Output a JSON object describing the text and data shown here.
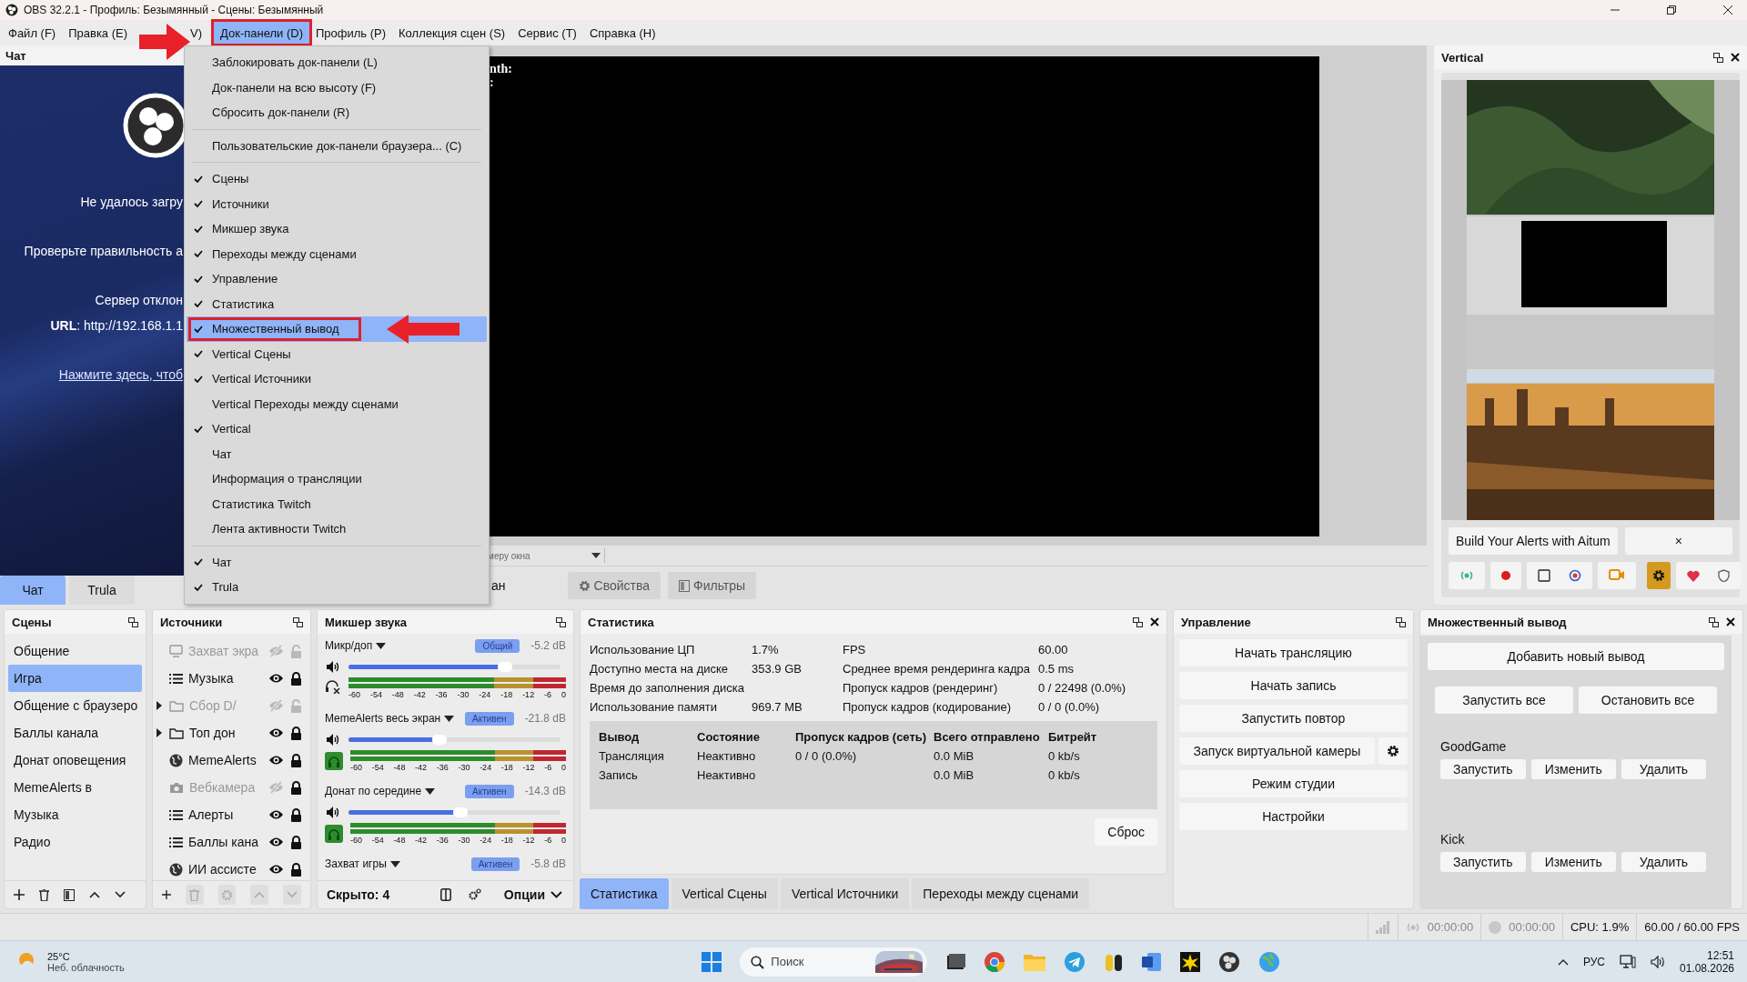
{
  "window": {
    "title": "OBS 32.2.1 - Профиль: Безымянный - Сцены: Безымянный"
  },
  "menubar": [
    {
      "label": "Файл (F)",
      "selected": false
    },
    {
      "label": "Правка (E)",
      "selected": false
    },
    {
      "label": "V)",
      "selected": false
    },
    {
      "label": "Док-панели (D)",
      "selected": true
    },
    {
      "label": "Профиль (P)",
      "selected": false
    },
    {
      "label": "Коллекция сцен (S)",
      "selected": false
    },
    {
      "label": "Сервис (T)",
      "selected": false
    },
    {
      "label": "Справка (H)",
      "selected": false
    }
  ],
  "dock_menu": {
    "groups": [
      [
        {
          "label": "Заблокировать док-панели (L)",
          "checked": false,
          "selected": false
        },
        {
          "label": "Док-панели на всю высоту (F)",
          "checked": false,
          "selected": false
        },
        {
          "label": "Сбросить док-панели (R)",
          "checked": false,
          "selected": false
        }
      ],
      [
        {
          "label": "Пользовательские док-панели браузера... (C)",
          "checked": false,
          "selected": false
        }
      ],
      [
        {
          "label": "Сцены",
          "checked": true,
          "selected": false
        },
        {
          "label": "Источники",
          "checked": true,
          "selected": false
        },
        {
          "label": "Микшер звука",
          "checked": true,
          "selected": false
        },
        {
          "label": "Переходы между сценами",
          "checked": true,
          "selected": false
        },
        {
          "label": "Управление",
          "checked": true,
          "selected": false
        },
        {
          "label": "Статистика",
          "checked": true,
          "selected": false
        },
        {
          "label": "Множественный вывод",
          "checked": true,
          "selected": true
        },
        {
          "label": "Vertical Сцены",
          "checked": true,
          "selected": false
        },
        {
          "label": "Vertical Источники",
          "checked": true,
          "selected": false
        },
        {
          "label": "Vertical Переходы между сценами",
          "checked": false,
          "selected": false
        },
        {
          "label": "Vertical",
          "checked": true,
          "selected": false
        },
        {
          "label": "Чат",
          "checked": false,
          "selected": false
        },
        {
          "label": "Информация о трансляции",
          "checked": false,
          "selected": false
        },
        {
          "label": "Статистика Twitch",
          "checked": false,
          "selected": false
        },
        {
          "label": "Лента активности Twitch",
          "checked": false,
          "selected": false
        }
      ],
      [
        {
          "label": "Чат",
          "checked": true,
          "selected": false
        },
        {
          "label": "Trula",
          "checked": true,
          "selected": false
        }
      ]
    ]
  },
  "chat_dock": {
    "title": "Чат",
    "lines": [
      "Не удалось загру",
      "Проверьте правильность а",
      "Сервер отклон",
      "**URL**: http://192.168.1.1"
    ],
    "link": "Нажмите здесь, чтоб",
    "tabs": [
      {
        "label": "Чат",
        "selected": true
      },
      {
        "label": "Trula",
        "selected": false
      }
    ]
  },
  "preview": {
    "overlay_lines": [
      "nth:",
      ":"
    ],
    "scale_field": "меру окна",
    "source_label": "ан",
    "buttons": [
      {
        "label": "Свойства"
      },
      {
        "label": "Фильтры"
      }
    ]
  },
  "vertical_dock": {
    "title": "Vertical",
    "closable": true,
    "alert_button": "Build Your Alerts with Aitum",
    "dismiss": "×"
  },
  "scenes": {
    "title": "Сцены",
    "closable": false,
    "items": [
      {
        "name": "Общение",
        "selected": false
      },
      {
        "name": "Игра",
        "selected": true
      },
      {
        "name": "Общение с браузеро",
        "selected": false
      },
      {
        "name": "Баллы канала",
        "selected": false
      },
      {
        "name": "Донат оповещения",
        "selected": false
      },
      {
        "name": "MemeAlerts в",
        "selected": false
      },
      {
        "name": "Музыка",
        "selected": false
      },
      {
        "name": "Радио",
        "selected": false
      }
    ]
  },
  "sources": {
    "title": "Источники",
    "closable": false,
    "items": [
      {
        "name": "Захват экра",
        "kind": "display",
        "expandable": false,
        "visible": false,
        "locked": false
      },
      {
        "name": "Музыка",
        "kind": "list",
        "expandable": false,
        "visible": true,
        "locked": true
      },
      {
        "name": "Сбор D/",
        "kind": "folder",
        "expandable": true,
        "visible": false,
        "locked": false
      },
      {
        "name": "Топ дон",
        "kind": "folder",
        "expandable": true,
        "visible": true,
        "locked": true
      },
      {
        "name": "MemeAlerts",
        "kind": "globe",
        "expandable": false,
        "visible": true,
        "locked": true
      },
      {
        "name": "Вебкамера",
        "kind": "camera",
        "expandable": false,
        "visible": false,
        "locked": true
      },
      {
        "name": "Алерты",
        "kind": "list",
        "expandable": false,
        "visible": true,
        "locked": true
      },
      {
        "name": "Баллы кана",
        "kind": "list",
        "expandable": false,
        "visible": true,
        "locked": true
      },
      {
        "name": "ИИ ассисте",
        "kind": "globe",
        "expandable": false,
        "visible": true,
        "locked": true
      }
    ]
  },
  "mixer": {
    "title": "Микшер звука",
    "closable": false,
    "channels": [
      {
        "name": "Микр/доп",
        "badge": "Общий",
        "reading": "-5.2 dB",
        "level": 0.74,
        "monitoring": false,
        "scale": [
          "-60",
          "-54",
          "-48",
          "-42",
          "-36",
          "-30",
          "-24",
          "-18",
          "-12",
          "-6",
          "0"
        ]
      },
      {
        "name": "MemeAlerts весь экран",
        "badge": "Активен",
        "reading": "-21.8 dB",
        "level": 0.43,
        "monitoring": true,
        "scale": [
          "-60",
          "-54",
          "-48",
          "-42",
          "-36",
          "-30",
          "-24",
          "-18",
          "-12",
          "-6",
          "0"
        ]
      },
      {
        "name": "Донат по середине",
        "badge": "Активен",
        "reading": "-14.3 dB",
        "level": 0.53,
        "monitoring": true,
        "scale": [
          "-60",
          "-54",
          "-48",
          "-42",
          "-36",
          "-30",
          "-24",
          "-18",
          "-12",
          "-6",
          "0"
        ]
      },
      {
        "name": "Захват игры",
        "badge": "Активен",
        "reading": "-5.8 dB"
      }
    ],
    "hidden_count": "Скрыто: 4",
    "options": "Опции"
  },
  "stats": {
    "title": "Статистика",
    "closable": true,
    "left": [
      {
        "label": "Использование ЦП",
        "value": "1.7%"
      },
      {
        "label": "Доступно места на диске",
        "value": "353.9 GB"
      },
      {
        "label": "Время до заполнения диска"
      },
      {
        "label": "Использование памяти",
        "value": "969.7 MB"
      }
    ],
    "right": [
      {
        "label": "FPS",
        "value": "60.00"
      },
      {
        "label": "Среднее время рендеринга кадра",
        "value": "0.5 ms"
      },
      {
        "label": "Пропуск кадров (рендеринг)",
        "value": "0 / 22498 (0.0%)"
      },
      {
        "label": "Пропуск кадров (кодирование)",
        "value": "0 / 0 (0.0%)"
      }
    ],
    "table": {
      "columns": [
        "Вывод",
        "Состояние",
        "Пропуск кадров (сеть)",
        "Всего отправлено",
        "Битрейт"
      ],
      "rows": [
        {
          "output": "Трансляция",
          "status": "Неактивно",
          "dropped": "0 / 0 (0.0%)",
          "sent": "0.0 MiB",
          "bitrate": "0 kb/s"
        },
        {
          "output": "Запись",
          "status": "Неактивно",
          "sent": "0.0 MiB",
          "bitrate": "0 kb/s"
        }
      ]
    },
    "reset": "Сброс",
    "tabs": [
      {
        "label": "Статистика",
        "selected": true
      },
      {
        "label": "Vertical Сцены",
        "selected": false
      },
      {
        "label": "Vertical Источники",
        "selected": false
      },
      {
        "label": "Переходы между сценами",
        "selected": false
      }
    ]
  },
  "controls": {
    "title": "Управление",
    "closable": false,
    "buttons": [
      {
        "label": "Начать трансляцию",
        "settings": false
      },
      {
        "label": "Начать запись",
        "settings": false
      },
      {
        "label": "Запустить повтор",
        "settings": false
      },
      {
        "label": "Запуск виртуальной камеры",
        "settings": true
      },
      {
        "label": "Режим студии",
        "settings": false
      },
      {
        "label": "Настройки",
        "settings": false
      }
    ]
  },
  "multi_output": {
    "title": "Множественный вывод",
    "closable": true,
    "add": "Добавить новый вывод",
    "start_all": "Запустить все",
    "stop_all": "Остановить все",
    "outputs": [
      {
        "name": "GoodGame",
        "buttons": [
          "Запустить",
          "Изменить",
          "Удалить"
        ]
      },
      {
        "name": "Kick",
        "buttons": [
          "Запустить",
          "Изменить",
          "Удалить"
        ]
      }
    ]
  },
  "status_bar": {
    "stream_time": "00:00:00",
    "record_time": "00:00:00",
    "cpu": "CPU: 1.9%",
    "fps": "60.00 / 60.00 FPS"
  },
  "taskbar": {
    "weather": {
      "temp": "25°C",
      "desc": "Неб. облачность"
    },
    "search": {
      "placeholder": "Поиск"
    },
    "language": "РУС",
    "time": "12:51",
    "date": "01.08.2026"
  }
}
